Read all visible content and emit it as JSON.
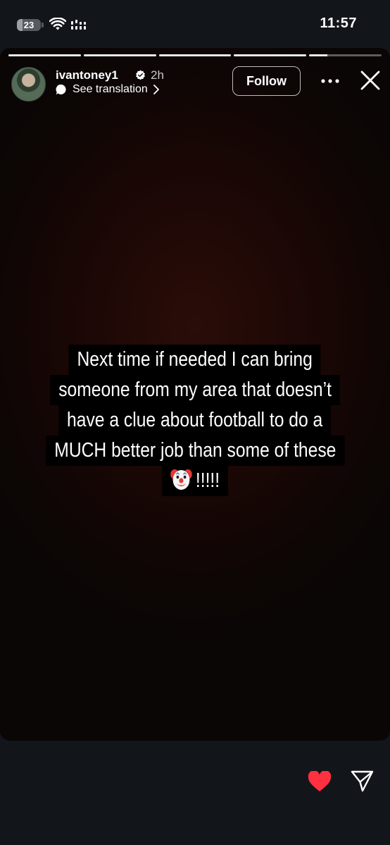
{
  "status_bar": {
    "battery_level": "23",
    "battery_fraction": 0.23,
    "time": "11:57"
  },
  "story": {
    "progress_segments": [
      1,
      1,
      1,
      1,
      0.25
    ],
    "user": {
      "username": "ivantoney1",
      "verified": true,
      "time_ago": "2h",
      "translate_label": "See translation"
    },
    "follow_label": "Follow",
    "caption_lines": [
      "Next time if needed I can bring",
      "someone from my area that doesn’t",
      "have a clue about football to do a",
      "MUCH better job than some of these"
    ],
    "caption_last_line": "!!!!!",
    "caption_emoji": "clown-face"
  },
  "colors": {
    "like_red": "#ff3040",
    "background": "#12161b"
  }
}
